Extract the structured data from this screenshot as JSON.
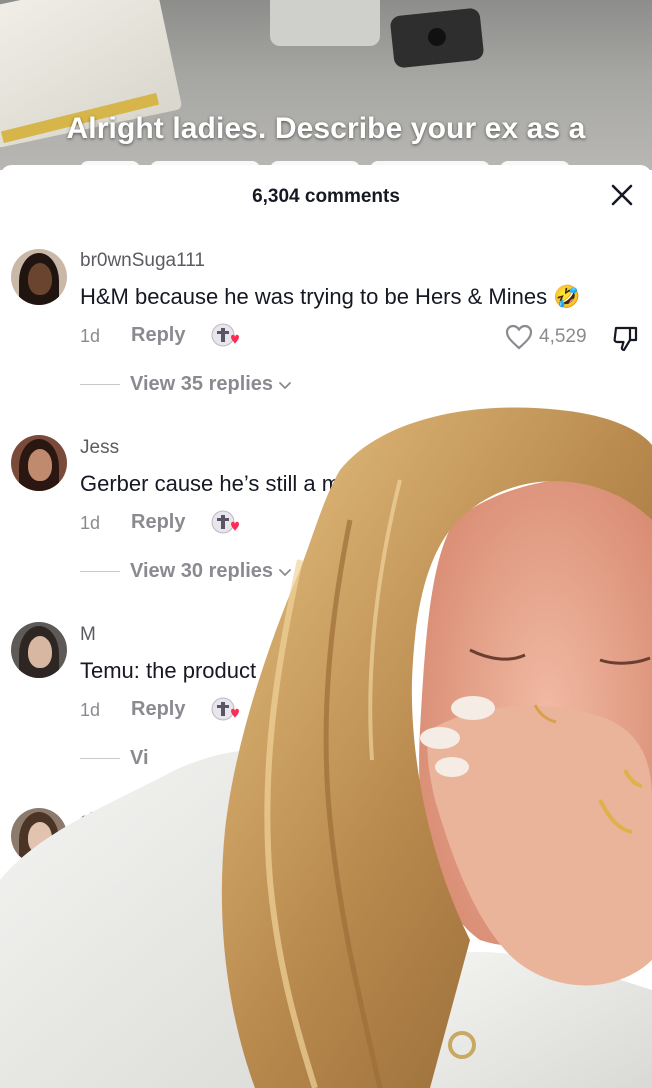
{
  "video": {
    "caption": "Alright ladies. Describe your ex as a"
  },
  "sheet": {
    "comment_count": "6,304 comments",
    "close_icon": "close-icon"
  },
  "comments": [
    {
      "username": "br0wnSuga111",
      "text": "H&M because he was trying to be Hers & Mines",
      "emoji": "🤣",
      "time": "1d",
      "reply_label": "Reply",
      "likes": "4,529",
      "view_replies": "View 35 replies"
    },
    {
      "username": "Jess",
      "text": "Gerber cause he’s still a m",
      "time": "1d",
      "reply_label": "Reply",
      "view_replies": "View 30 replies"
    },
    {
      "username": "M",
      "text": "Temu: the product",
      "time": "1d",
      "reply_label": "Reply",
      "view_replies": "Vi"
    },
    {
      "username": "ch"
    }
  ],
  "colors": {
    "heart_badge": "#fe2c55",
    "secondary_text": "#8a8b91",
    "primary_text": "#161823"
  }
}
